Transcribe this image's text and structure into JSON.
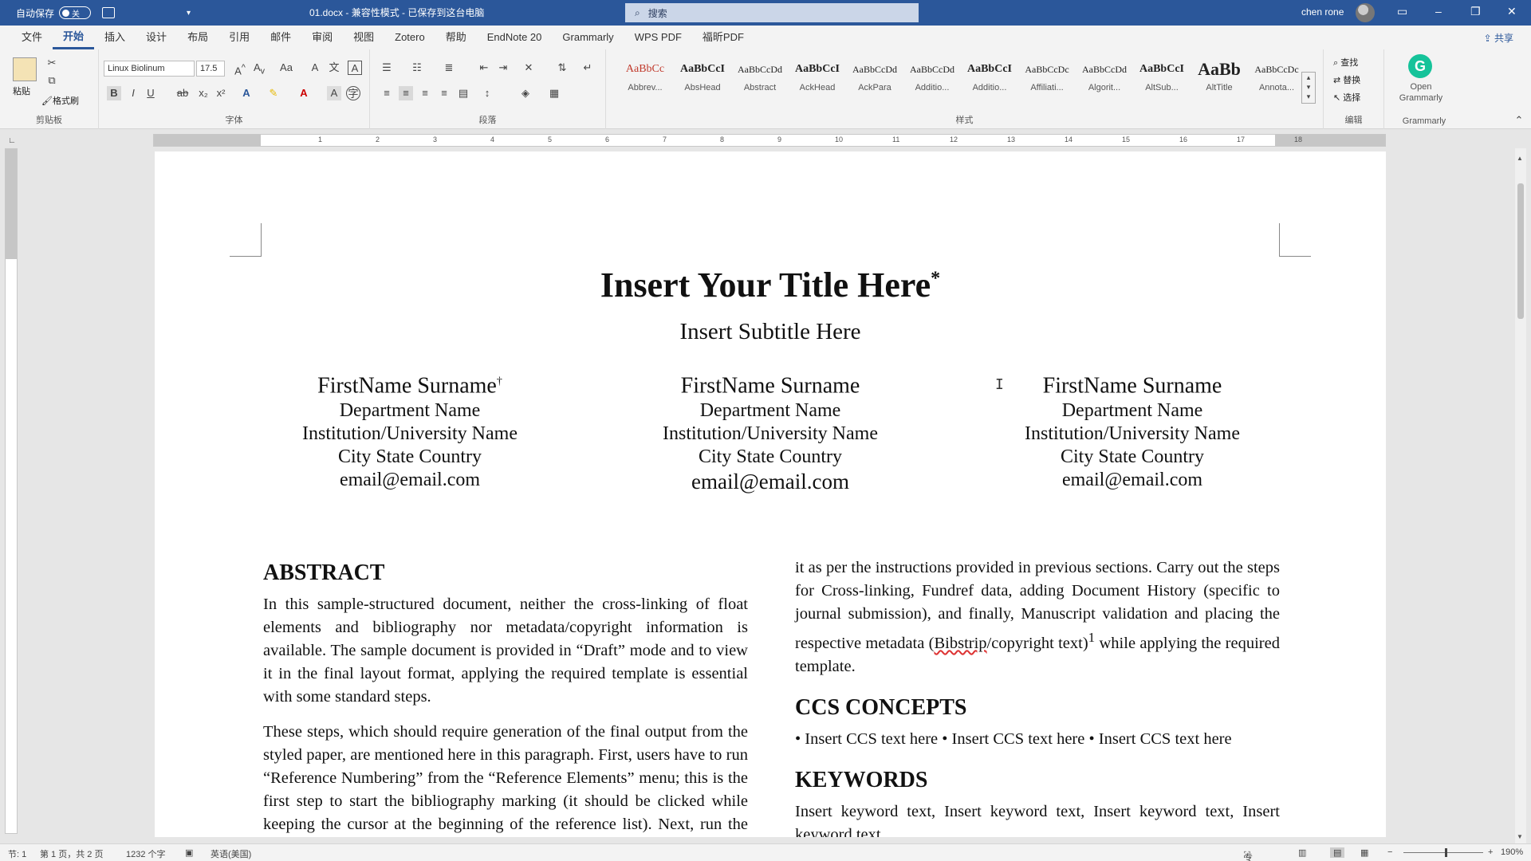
{
  "titlebar": {
    "autosave_label": "自动保存",
    "autosave_state": "关",
    "doc_title": "01.docx - 兼容性模式 - 已保存到这台电脑",
    "search_placeholder": "搜索",
    "user_name": "chen rone"
  },
  "menu": {
    "tabs": [
      "文件",
      "开始",
      "插入",
      "设计",
      "布局",
      "引用",
      "邮件",
      "审阅",
      "视图",
      "Zotero",
      "帮助",
      "EndNote 20",
      "Grammarly",
      "WPS PDF",
      "福昕PDF"
    ],
    "active_tab": "开始",
    "share_label": "共享"
  },
  "ribbon": {
    "clipboard": {
      "paste_label": "粘贴",
      "format_painter_label": "格式刷",
      "group_label": "剪贴板"
    },
    "font": {
      "font_name": "Linux Biolinum",
      "font_size": "17.5",
      "group_label": "字体"
    },
    "paragraph": {
      "group_label": "段落"
    },
    "styles": {
      "group_label": "样式",
      "items": [
        {
          "sample": "AaBbCc",
          "name": "Abbrev..."
        },
        {
          "sample": "AaBbCcI",
          "name": "AbsHead"
        },
        {
          "sample": "AaBbCcDd",
          "name": "Abstract"
        },
        {
          "sample": "AaBbCcI",
          "name": "AckHead"
        },
        {
          "sample": "AaBbCcDd",
          "name": "AckPara"
        },
        {
          "sample": "AaBbCcDd",
          "name": "Additio..."
        },
        {
          "sample": "AaBbCcI",
          "name": "Additio..."
        },
        {
          "sample": "AaBbCcDc",
          "name": "Affiliati..."
        },
        {
          "sample": "AaBbCcDd",
          "name": "Algorit..."
        },
        {
          "sample": "AaBbCcI",
          "name": "AltSub..."
        },
        {
          "sample": "AaBb",
          "name": "AltTitle"
        },
        {
          "sample": "AaBbCcDc",
          "name": "Annota..."
        }
      ]
    },
    "editing": {
      "find_label": "查找",
      "replace_label": "替换",
      "select_label": "选择",
      "group_label": "编辑"
    },
    "grammarly": {
      "button_label": "Open Grammarly",
      "group_label": "Grammarly"
    }
  },
  "document": {
    "title": "Insert Your Title Here",
    "title_mark": "*",
    "subtitle": "Insert Subtitle Here",
    "authors": [
      {
        "name": "FirstName Surname",
        "mark": "†",
        "department": "Department Name",
        "institution": "Institution/University Name",
        "location": "City State Country",
        "email": "email@email.com"
      },
      {
        "name": "FirstName Surname",
        "mark": "",
        "department": "Department Name",
        "institution": "Institution/University Name",
        "location": "City State Country",
        "email": "email@email.com"
      },
      {
        "name": "FirstName Surname",
        "mark": "",
        "department": "Department Name",
        "institution": "Institution/University Name",
        "location": "City State Country",
        "email": "email@email.com"
      }
    ],
    "abstract_heading": "ABSTRACT",
    "abstract_p1": "In this sample-structured document, neither the cross-linking of float elements and bibliography nor metadata/copyright information is available. The sample document is provided in “Draft” mode and to view it in the final layout format, applying the required template is essential with some standard steps.",
    "abstract_p2": "These steps, which should require generation of the final output from the styled paper, are mentioned here in this paragraph. First, users have to run “Reference Numbering” from the “Reference Elements” menu; this is the first step to start the bibliography marking (it should be clicked while keeping the cursor at the beginning of the reference list). Next, run the desired final layout",
    "right_p1_a": "it as per the instructions provided in previous sections. Carry out the steps for Cross-linking, Fundref data, adding Document History (specific to journal submission), and finally, Manuscript validation and placing the respective metadata (",
    "right_p1_spell": "Bibstrip",
    "right_p1_b": "/copyright text)",
    "right_p1_sup": "1",
    "right_p1_c": " while applying the required template.",
    "ccs_heading": "CCS CONCEPTS",
    "ccs_text": "• Insert CCS text here • Insert CCS text here • Insert CCS text here",
    "keywords_heading": "KEYWORDS",
    "keywords_text": "Insert keyword text, Insert keyword text, Insert keyword text, Insert keyword text"
  },
  "statusbar": {
    "section": "节: 1",
    "page": "第 1 页，共 2 页",
    "words": "1232 个字",
    "language": "英语(美国)",
    "focus": "专注",
    "zoom": "190%"
  }
}
